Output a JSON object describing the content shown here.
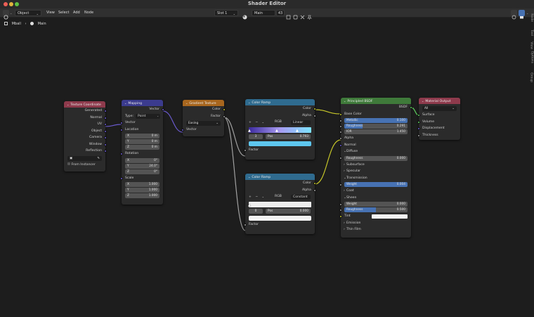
{
  "window": {
    "title": "Shader Editor"
  },
  "header": {
    "object_mode": "Object",
    "menus": [
      "View",
      "Select",
      "Add",
      "Node"
    ],
    "slot": "Slot 1",
    "material": "Main",
    "user_count": "43"
  },
  "breadcrumb": {
    "object": "Mball",
    "material": "Main"
  },
  "sidebar_tabs": [
    "Node",
    "Tool",
    "View",
    "Options",
    "Group"
  ],
  "nodes": {
    "texcoord": {
      "title": "Texture Coordinate",
      "outputs": [
        "Generated",
        "Normal",
        "UV",
        "Object",
        "Camera",
        "Window",
        "Reflection"
      ],
      "object_placeholder": "",
      "from_instancer": "From Instancer"
    },
    "mapping": {
      "title": "Mapping",
      "out": "Vector",
      "type_label": "Type:",
      "type_value": "Point",
      "vector_in": "Vector",
      "location": "Location",
      "loc": [
        {
          "axis": "X",
          "val": "0 m"
        },
        {
          "axis": "Y",
          "val": "0 m"
        },
        {
          "axis": "Z",
          "val": "0 m"
        }
      ],
      "rotation": "Rotation",
      "rot": [
        {
          "axis": "X",
          "val": "0°"
        },
        {
          "axis": "Y",
          "val": "24.0°"
        },
        {
          "axis": "Z",
          "val": "0°"
        }
      ],
      "scale": "Scale",
      "scl": [
        {
          "axis": "X",
          "val": "1.000"
        },
        {
          "axis": "Y",
          "val": "1.000"
        },
        {
          "axis": "Z",
          "val": "1.000"
        }
      ]
    },
    "gradient": {
      "title": "Gradient Texture",
      "out_color": "Color",
      "out_factor": "Factor",
      "type": "Easing",
      "vector_in": "Vector"
    },
    "ramp1": {
      "title": "Color Ramp",
      "out_color": "Color",
      "out_alpha": "Alpha",
      "color_mode": "RGB",
      "interp": "Linear",
      "index": "3",
      "pos_label": "Pos",
      "pos": "0.793",
      "factor_in": "Factor"
    },
    "ramp2": {
      "title": "Color Ramp",
      "out_color": "Color",
      "out_alpha": "Alpha",
      "color_mode": "RGB",
      "interp": "Constant",
      "index": "0",
      "pos_label": "Pos",
      "pos": "0.000",
      "factor_in": "Factor"
    },
    "bsdf": {
      "title": "Principled BSDF",
      "out": "BSDF",
      "base_color": "Base Color",
      "metallic": "Metallic",
      "metallic_val": "0.100",
      "roughness": "Roughness",
      "roughness_val": "0.291",
      "ior": "IOR",
      "ior_val": "1.450",
      "alpha": "Alpha",
      "normal": "Normal",
      "diffuse": "Diffuse",
      "diff_rough": "Roughness",
      "diff_rough_val": "0.000",
      "subsurface": "Subsurface",
      "specular": "Specular",
      "transmission": "Transmission",
      "weight": "Weight",
      "weight_val": "0.004",
      "coat": "Coat",
      "sheen": "Sheen",
      "sheen_weight": "Weight",
      "sheen_weight_val": "0.000",
      "sheen_rough": "Roughness",
      "sheen_rough_val": "0.500",
      "tint": "Tint",
      "emission": "Emission",
      "thin_film": "Thin Film"
    },
    "output": {
      "title": "Material Output",
      "target": "All",
      "inputs": [
        "Surface",
        "Volume",
        "Displacement",
        "Thickness"
      ]
    }
  },
  "colors": {
    "header_input": "#8e3a4c",
    "header_vector": "#3b3b8e",
    "header_texture": "#a8661e",
    "header_converter": "#2f6b8f",
    "header_shader": "#3f7a3a",
    "header_output": "#8e3a4c",
    "accent_blue": "#4772b3"
  }
}
